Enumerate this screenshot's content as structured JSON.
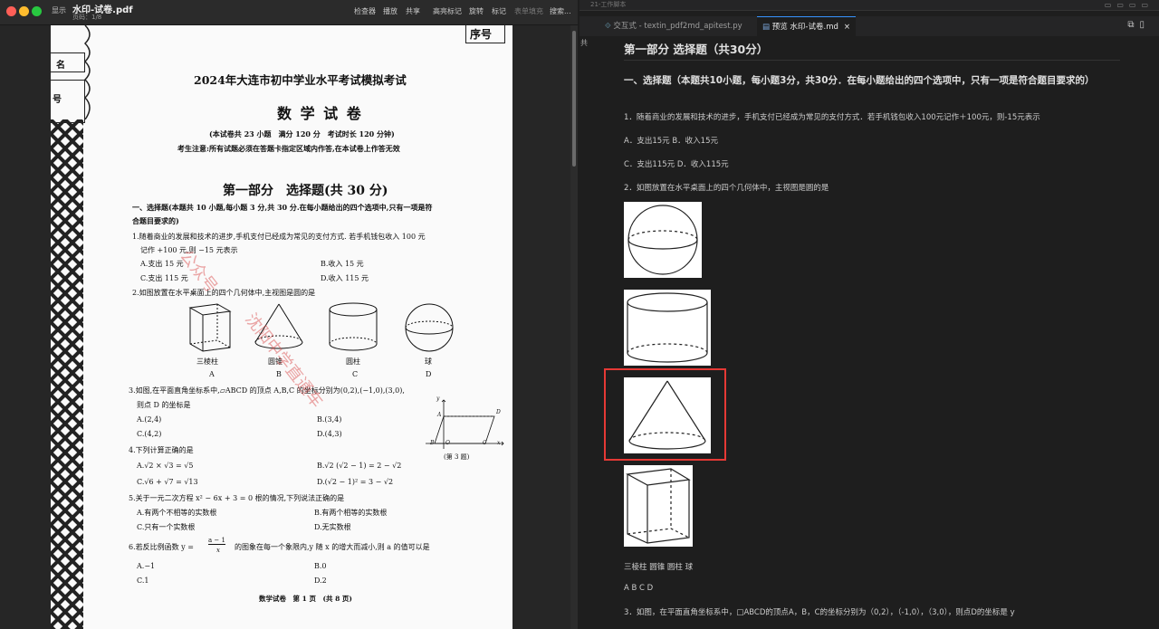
{
  "pdf_viewer": {
    "title": "水印-试卷.pdf",
    "page_indicator": "页码：1/8",
    "sidebar_label": "显示",
    "toolbar": {
      "inspector": "检查器",
      "play": "播放",
      "share": "共享",
      "highlight": "高亮标记",
      "rotate": "旋转",
      "markup": "标记",
      "form_fill": "表单填充",
      "search": "搜索..."
    }
  },
  "exam_page": {
    "seat_label": "序号",
    "name_label": "名",
    "number_label": "号",
    "title": "2024年大连市初中学业水平考试模拟考试",
    "subject": "数 学 试 卷",
    "info": "(本试卷共 23 小题　满分 120 分　考试时长 120 分钟)",
    "notice": "考生注意:所有试题必须在答题卡指定区域内作答,在本试卷上作答无效",
    "part_title": "第一部分　选择题(共 30 分)",
    "section_intro_1": "一、选择题(本题共 10 小题,每小题 3 分,共 30 分.在每小题给出的四个选项中,只有一项是符",
    "section_intro_2": "合题目要求的)",
    "q1_a": "1.随着商业的发展和技术的进步,手机支付已经成为常见的支付方式. 若手机钱包收入 100 元",
    "q1_b": "记作 +100 元,则 −15 元表示",
    "q1_optA": "A.支出 15 元",
    "q1_optB": "B.收入 15 元",
    "q1_optC": "C.支出 115 元",
    "q1_optD": "D.收入 115 元",
    "q2": "2.如图放置在水平桌面上的四个几何体中,主视图是圆的是",
    "q2_names": [
      "三棱柱",
      "圆锥",
      "圆柱",
      "球"
    ],
    "q2_letters": [
      "A",
      "B",
      "C",
      "D"
    ],
    "q3_a": "3.如图,在平面直角坐标系中,▱ABCD 的顶点 A,B,C 的坐标分别为(0,2),(−1,0),(3,0),",
    "q3_b": "则点 D 的坐标是",
    "q3_optA": "A.(2,4)",
    "q3_optB": "B.(3,4)",
    "q3_optC": "C.(4,2)",
    "q3_optD": "D.(4,3)",
    "q3_fig_caption": "(第 3 题)",
    "q3_fig_labels": {
      "y": "y",
      "A": "A",
      "D": "D",
      "B": "B",
      "O": "O",
      "C": "C",
      "x": "x"
    },
    "q4": "4.下列计算正确的是",
    "q4_optA": "A.√2 × √3 = √5",
    "q4_optB": "B.√2 (√2 − 1) = 2 − √2",
    "q4_optC": "C.√6 + √7 = √13",
    "q4_optD": "D.(√2 − 1)² = 3 − √2",
    "q5": "5.关于一元二次方程 x² − 6x + 3 = 0 根的情况,下列说法正确的是",
    "q5_optA": "A.有两个不相等的实数根",
    "q5_optB": "B.有两个相等的实数根",
    "q5_optC": "C.只有一个实数根",
    "q5_optD": "D.无实数根",
    "q6_a": "6.若反比例函数 y =",
    "q6_num": "a − 1",
    "q6_den": "x",
    "q6_b": "的图象在每一个象限内,y 随 x 的增大而减小,则 a 的值可以是",
    "q6_optA": "A.−1",
    "q6_optB": "B.0",
    "q6_optC": "C.1",
    "q6_optD": "D.2",
    "footer": "数学试卷　第 1 页　(共 8 页)",
    "watermark_1": "公众号",
    "watermark_2": "沈阳中学直通车"
  },
  "editor": {
    "top_strip_label": "21-工作脚本",
    "tabs": [
      {
        "label": "交互式 - textin_pdf2md_apitest.py"
      },
      {
        "label": "预览 水印-试卷.md"
      }
    ],
    "close_glyph": "×",
    "gutter_char": "共",
    "preview": {
      "h1": "第一部分 选择题（共30分）",
      "h2": "一、选择题（本题共10小题，每小题3分，共30分．在每小题给出的四个选项中，只有一项是符合题目要求的）",
      "p_q1": "1．随着商业的发展和技术的进步，手机支付已经成为常见的支付方式．若手机钱包收入100元记作＋100元，则-15元表示",
      "p_q1_ab": "A．支出15元 B．收入15元",
      "p_q1_cd": "C．支出115元 D．收入115元",
      "p_q2": "2．如图放置在水平桌面上的四个几何体中，主视图是圆的是",
      "p_names": "三棱柱 圆锥 圆柱 球",
      "p_letters": "A B C D",
      "p_q3": "3．如图，在平面直角坐标系中，□ABCD的顶点A，B，C的坐标分别为（0,2），（-1,0），（3,0），则点D的坐标是 y"
    }
  }
}
